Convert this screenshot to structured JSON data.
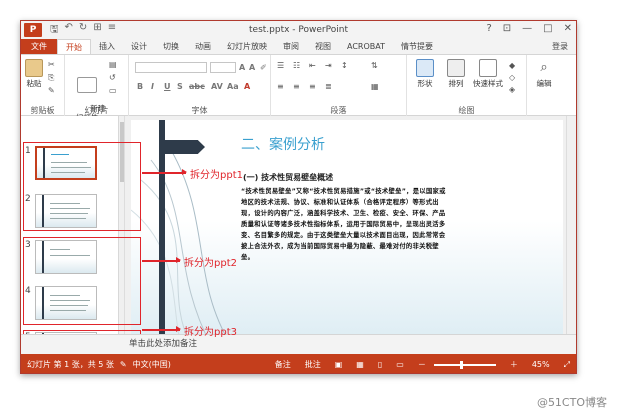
{
  "titlebar": {
    "app_icon": "P",
    "title": "test.pptx - PowerPoint",
    "help": "?",
    "restore": "⊡",
    "minimize": "—",
    "maximize": "□",
    "close": "✕"
  },
  "qat": {
    "save": "🖫",
    "undo": "↶",
    "redo": "↻",
    "start": "⊞",
    "customize": "≡"
  },
  "tabs": [
    "文件",
    "开始",
    "插入",
    "设计",
    "切换",
    "动画",
    "幻灯片放映",
    "审阅",
    "视图",
    "ACROBAT",
    "情节提要"
  ],
  "active_tab": "开始",
  "login": "登录",
  "ribbon": {
    "paste": "粘贴",
    "clipboard_label": "剪贴板",
    "new_slide": "新建\n幻灯片",
    "slides_label": "幻灯片",
    "font_label": "字体",
    "font_buttons": [
      "B",
      "I",
      "U",
      "S",
      "abc",
      "AV",
      "Aa",
      "A"
    ],
    "paragraph_label": "段落",
    "shapes": "形状",
    "arrange": "排列",
    "quick_styles": "快速样式",
    "drawing_label": "绘图",
    "edit": "编辑"
  },
  "thumbnails": [
    {
      "num": "1"
    },
    {
      "num": "2"
    },
    {
      "num": "3"
    },
    {
      "num": "4"
    },
    {
      "num": "5"
    }
  ],
  "slide": {
    "title": "二、案例分析",
    "subtitle": "(一) 技术性贸易壁垒概述",
    "body": "“技术性贸易壁垒”又称“技术性贸易措施”或“技术壁垒”，是以国家或地区的技术法规、协议、标准和认证体系（合格评定程序）等形式出现，设计的内容广泛，涵盖科学技术、卫生、检疫、安全、环保、产品质量和认证等诸多技术性指标体系，运用于国际贸易中，呈现出灵活多变、名目繁多的规定。由于这类壁垒大量以技术面目出现，因此常常会披上合法外衣，成为当前国际贸易中最为隐蔽、最难对付的非关税壁垒。"
  },
  "annotations": [
    "拆分为ppt1",
    "拆分为ppt2",
    "拆分为ppt3"
  ],
  "notes": "单击此处添加备注",
  "status": {
    "slide_info": "幻灯片 第 1 张，共 5 张",
    "language": "中文(中国)",
    "notes_btn": "备注",
    "comments_btn": "批注",
    "zoom_minus": "－",
    "zoom_plus": "＋",
    "zoom": "45%",
    "fit": "⤢"
  },
  "watermark": "@51CTO博客"
}
